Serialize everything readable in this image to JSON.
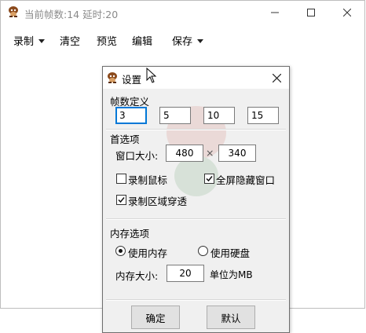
{
  "window": {
    "title": "当前帧数:14  延时:20",
    "icon": "bug-app-icon",
    "controls": {
      "minimize": "minimize-icon",
      "maximize": "maximize-icon",
      "close": "close-icon"
    }
  },
  "menu": {
    "record": "录制",
    "clear": "清空",
    "preview": "预览",
    "edit": "编辑",
    "save": "保存"
  },
  "dialog": {
    "title": "设置",
    "frame_group": {
      "label": "帧数定义",
      "values": [
        "3",
        "5",
        "10",
        "15"
      ]
    },
    "preferences": {
      "label": "首选项",
      "window_size_label": "窗口大小:",
      "width": "480",
      "times": "×",
      "height": "340",
      "record_mouse": {
        "label": "录制鼠标",
        "checked": false
      },
      "fullscreen_hide": {
        "label": "全屏隐藏窗口",
        "checked": true
      },
      "record_region_through": {
        "label": "录制区域穿透",
        "checked": true
      }
    },
    "memory": {
      "label": "内存选项",
      "use_memory": {
        "label": "使用内存",
        "selected": true
      },
      "use_disk": {
        "label": "使用硬盘",
        "selected": false
      },
      "size_label": "内存大小:",
      "size_value": "20",
      "unit_label": "单位为MB"
    },
    "buttons": {
      "ok": "确定",
      "default": "默认"
    }
  },
  "colors": {
    "focus_border": "#0078d7",
    "dialog_bg": "#f0f0f0",
    "title_text": "#8a8a8a"
  }
}
